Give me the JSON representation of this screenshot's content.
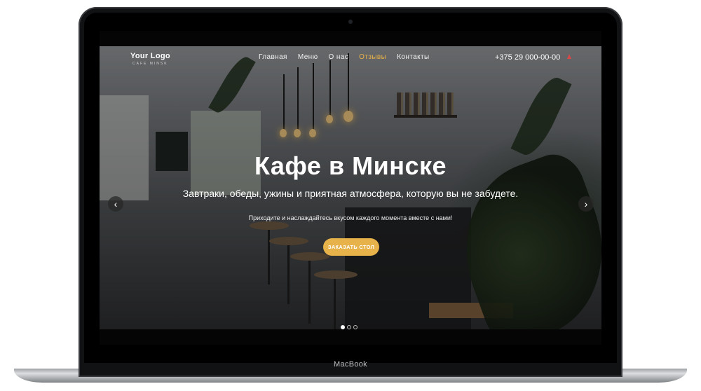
{
  "device": {
    "brand_label": "MacBook"
  },
  "nav": {
    "logo": "Your Logo",
    "logo_sub": "CAFE MINSK",
    "items": [
      {
        "label": "Главная",
        "active": false
      },
      {
        "label": "Меню",
        "active": false
      },
      {
        "label": "О нас",
        "active": false
      },
      {
        "label": "Отзывы",
        "active": true
      },
      {
        "label": "Контакты",
        "active": false
      }
    ],
    "phone": "+375 29 000-00-00"
  },
  "hero": {
    "title": "Кафе в Минске",
    "subtitle": "Завтраки, обеды, ужины и приятная атмосфера, которую вы не забудете.",
    "tagline": "Приходите и наслаждайтесь вкусом каждого момента вместе с нами!",
    "cta_label": "ЗАКАЗАТЬ СТОЛ",
    "prev_arrow": "‹",
    "next_arrow": "›",
    "slides_total": 3,
    "slide_active": 1
  },
  "colors": {
    "accent": "#e8b24a",
    "frame": "#111214",
    "phone_icon": "#d94848"
  }
}
